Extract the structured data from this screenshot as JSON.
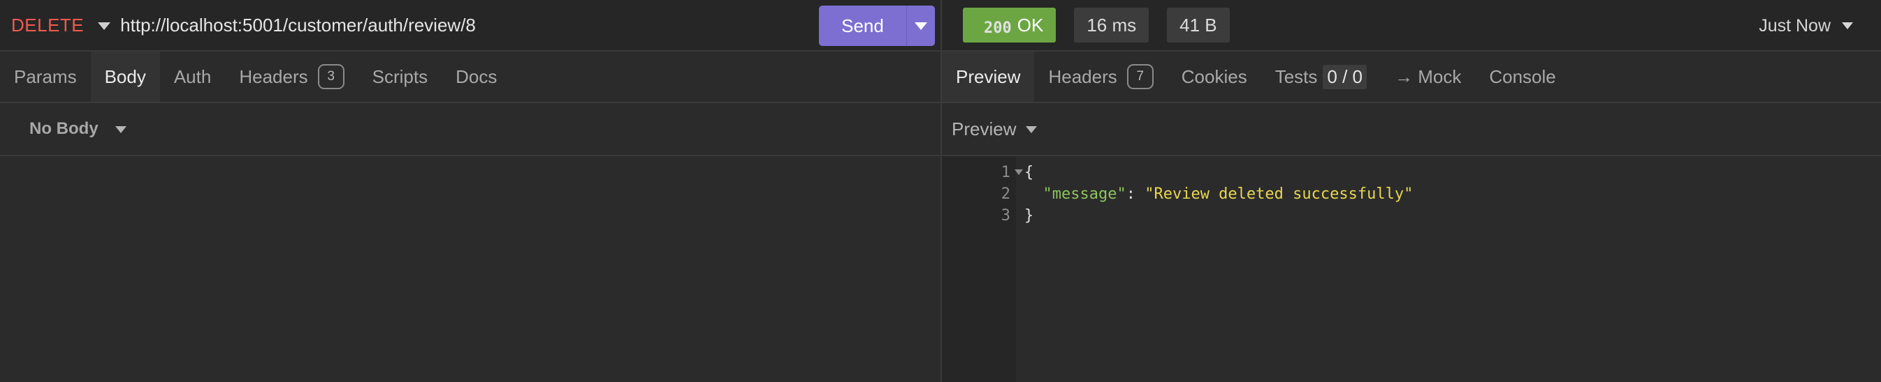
{
  "request": {
    "method": "DELETE",
    "url": "http://localhost:5001/customer/auth/review/8",
    "send_label": "Send"
  },
  "request_tabs": [
    {
      "label": "Params"
    },
    {
      "label": "Body"
    },
    {
      "label": "Auth"
    },
    {
      "label": "Headers",
      "badge": "3"
    },
    {
      "label": "Scripts"
    },
    {
      "label": "Docs"
    }
  ],
  "body": {
    "type_label": "No Body"
  },
  "response": {
    "status_code": "200",
    "status_text": "OK",
    "time": "16 ms",
    "size": "41 B",
    "timestamp": "Just Now",
    "preview_mode": "Preview"
  },
  "response_tabs": [
    {
      "label": "Preview"
    },
    {
      "label": "Headers",
      "badge": "7"
    },
    {
      "label": "Cookies"
    },
    {
      "label": "Tests",
      "count": "0 / 0"
    },
    {
      "label": "→ Mock"
    },
    {
      "label": "Console"
    }
  ],
  "code": {
    "line_numbers": [
      "1",
      "2",
      "3"
    ],
    "open_brace": "{",
    "key": "\"message\"",
    "colon": ": ",
    "value": "\"Review deleted successfully\"",
    "close_brace": "}"
  },
  "colors": {
    "method": "#f05a50",
    "send_button": "#7c6fd1",
    "status_ok": "#6ca642",
    "json_key": "#8dc35d",
    "json_string": "#e7d64f"
  }
}
